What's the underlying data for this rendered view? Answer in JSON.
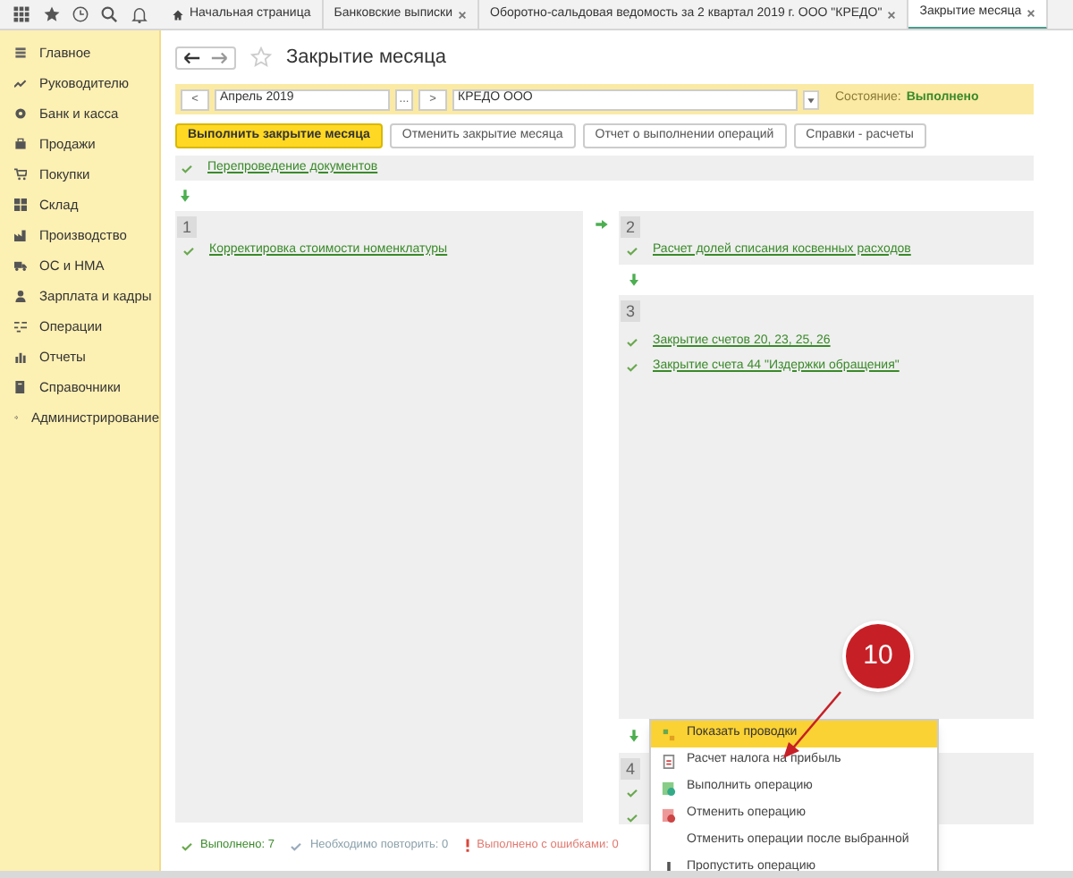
{
  "tabs": [
    {
      "label": "Начальная страница",
      "kind": "home",
      "closable": false,
      "selected": false
    },
    {
      "label": "Банковские выписки",
      "kind": "doc",
      "closable": true,
      "selected": false
    },
    {
      "label": "Оборотно-сальдовая ведомость за 2 квартал 2019 г. ООО \"КРЕДО\"",
      "kind": "doc",
      "closable": true,
      "selected": false
    },
    {
      "label": "Закрытие месяца",
      "kind": "doc",
      "closable": true,
      "selected": true
    }
  ],
  "sidebar": {
    "items": [
      {
        "label": "Главное"
      },
      {
        "label": "Руководителю"
      },
      {
        "label": "Банк и касса"
      },
      {
        "label": "Продажи"
      },
      {
        "label": "Покупки"
      },
      {
        "label": "Склад"
      },
      {
        "label": "Производство"
      },
      {
        "label": "ОС и НМА"
      },
      {
        "label": "Зарплата и кадры"
      },
      {
        "label": "Операции"
      },
      {
        "label": "Отчеты"
      },
      {
        "label": "Справочники"
      },
      {
        "label": "Администрирование"
      }
    ]
  },
  "page": {
    "title": "Закрытие месяца",
    "favorite": false
  },
  "filter": {
    "prev": "<",
    "period": "Апрель 2019",
    "choose": "...",
    "next": ">",
    "organization": "КРЕДО ООО",
    "state_label": "Состояние:",
    "state_value": "Выполнено"
  },
  "buttons": [
    {
      "label": "Выполнить закрытие месяца",
      "primary": true
    },
    {
      "label": "Отменить закрытие месяца",
      "primary": false
    },
    {
      "label": "Отчет о выполнении операций",
      "primary": false
    },
    {
      "label": "Справки - расчеты",
      "primary": false
    }
  ],
  "prelude": {
    "label": "Перепроведение документов",
    "done": true
  },
  "stages": [
    {
      "number": "1",
      "operations": [
        {
          "label": "Корректировка стоимости номенклатуры",
          "done": true
        }
      ]
    },
    {
      "number": "2",
      "operations": [
        {
          "label": "Расчет долей списания косвенных расходов",
          "done": true
        }
      ]
    },
    {
      "number": "3",
      "operations": [
        {
          "label": "Закрытие счетов 20, 23, 25, 26",
          "done": true
        },
        {
          "label": "Закрытие счета 44 \"Издержки обращения\"",
          "done": true
        }
      ]
    },
    {
      "number": "4",
      "operations": [
        {
          "done": true
        },
        {
          "done": true
        }
      ]
    }
  ],
  "context_menu": {
    "items": [
      {
        "label": "Показать проводки",
        "kind": "postings",
        "selected": true
      },
      {
        "label": "Расчет налога на прибыль",
        "kind": "report",
        "selected": false
      },
      {
        "label": "Выполнить операцию",
        "kind": "run",
        "selected": false
      },
      {
        "label": "Отменить операцию",
        "kind": "cancel",
        "selected": false
      },
      {
        "label": "Отменить операции после выбранной",
        "kind": "none",
        "selected": false
      },
      {
        "label": "Пропустить операцию",
        "kind": "skip",
        "selected": false
      }
    ]
  },
  "callout": {
    "label": "10"
  },
  "status_bar": [
    {
      "kind": "ok",
      "label": "Выполнено: 7"
    },
    {
      "kind": "repeat",
      "label": "Необходимо повторить: 0"
    },
    {
      "kind": "error",
      "label": "Выполнено с ошибками: 0"
    }
  ]
}
